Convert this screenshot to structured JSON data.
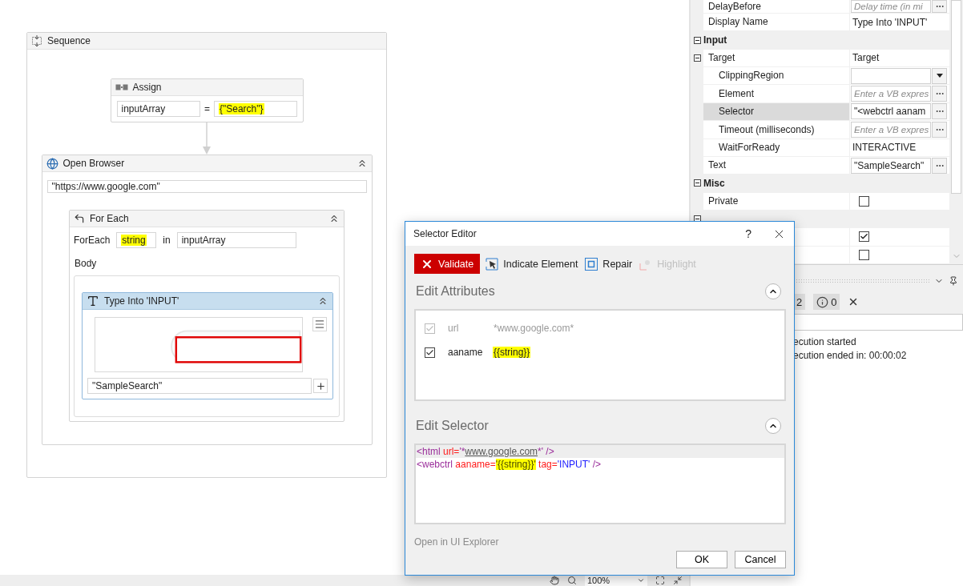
{
  "designer": {
    "sequence": {
      "title": "Sequence",
      "assign": {
        "title": "Assign",
        "target": "inputArray",
        "operator": "=",
        "value": {
          "text": "{\"Search\"}",
          "highlighted": true
        }
      },
      "open_browser": {
        "title": "Open Browser",
        "expanded": true,
        "url": "\"https://www.google.com\"",
        "for_each": {
          "title": "For Each",
          "expanded": true,
          "label": "ForEach",
          "item": {
            "text": "string",
            "highlighted": true
          },
          "in_label": "in",
          "collection": "inputArray",
          "body_label": "Body",
          "type_into": {
            "title": "Type Into 'INPUT'",
            "expanded": true,
            "selected": true,
            "text": "\"SampleSearch\""
          }
        }
      }
    }
  },
  "status_bar": {
    "zoom": "100%"
  },
  "properties": [
    {
      "kind": "field",
      "name": "DelayBefore",
      "placeholder": "Delay time (in mi",
      "has_button": true,
      "selected": false
    },
    {
      "kind": "field",
      "name": "Display Name",
      "value": "Type Into 'INPUT'",
      "selected": false
    },
    {
      "kind": "category",
      "name": "Input",
      "expanded": true,
      "children": [
        {
          "kind": "field",
          "name": "Target",
          "value": "Target",
          "expanded": true,
          "selected": false,
          "children": [
            {
              "kind": "dropdown",
              "name": "ClippingRegion",
              "selected": false
            },
            {
              "kind": "field",
              "name": "Element",
              "placeholder": "Enter a VB expres",
              "has_button": true,
              "selected": false
            },
            {
              "kind": "field",
              "name": "Selector",
              "value": "\"<webctrl aanam",
              "has_button": true,
              "selected": true
            },
            {
              "kind": "field",
              "name": "Timeout (milliseconds)",
              "placeholder": "Enter a VB expres",
              "has_button": true,
              "selected": false
            },
            {
              "kind": "field",
              "name": "WaitForReady",
              "value": "INTERACTIVE",
              "selected": false
            }
          ]
        },
        {
          "kind": "field",
          "name": "Text",
          "value": "\"SampleSearch\"",
          "has_button": true,
          "selected": false
        }
      ]
    },
    {
      "kind": "category",
      "name": "Misc",
      "expanded": true,
      "children": [
        {
          "kind": "checkbox",
          "name": "Private",
          "checked": false,
          "selected": false
        }
      ]
    },
    {
      "kind": "category",
      "expanded": true,
      "children": [
        {
          "kind": "checkbox",
          "checked": true,
          "selected": false
        },
        {
          "kind": "checkbox",
          "checked": false,
          "selected": false
        }
      ]
    }
  ],
  "output": {
    "error_count": "2",
    "info_count": "0",
    "lines": [
      "ecution started",
      "ecution ended in: 00:00:02"
    ]
  },
  "dialog": {
    "title": "Selector Editor",
    "help": "?",
    "toolbar": [
      {
        "kind": "validate",
        "label": "Validate",
        "disabled": false
      },
      {
        "kind": "indicate",
        "label": "Indicate Element",
        "disabled": false
      },
      {
        "kind": "repair",
        "label": "Repair",
        "disabled": false
      },
      {
        "kind": "highlight",
        "label": "Highlight",
        "disabled": true
      }
    ],
    "attributes_section": {
      "title": "Edit Attributes",
      "expanded": true,
      "attributes": [
        {
          "name": "url",
          "value": "*www.google.com*",
          "checked": true,
          "disabled": true,
          "highlighted": false
        },
        {
          "name": "aaname",
          "value": "{{string}}",
          "checked": true,
          "disabled": false,
          "highlighted": true
        }
      ]
    },
    "selector_section": {
      "title": "Edit Selector",
      "expanded": true,
      "lines": [
        {
          "current": true,
          "tokens": [
            {
              "text": "<html",
              "kind": "tag"
            },
            {
              "text": " url=",
              "kind": "attr"
            },
            {
              "text": "'*",
              "kind": "tag"
            },
            {
              "text": "www.google.com",
              "kind": "link"
            },
            {
              "text": "*' />",
              "kind": "tag"
            }
          ]
        },
        {
          "current": false,
          "tokens": [
            {
              "text": "<webctrl",
              "kind": "tag"
            },
            {
              "text": " aaname=",
              "kind": "attr"
            },
            {
              "text": "'{{string}}'",
              "kind": "value",
              "highlighted": true
            },
            {
              "text": " tag=",
              "kind": "attr"
            },
            {
              "text": "'INPUT'",
              "kind": "value"
            },
            {
              "text": " />",
              "kind": "tag"
            }
          ]
        }
      ]
    },
    "link": "Open in UI Explorer",
    "buttons": [
      {
        "label": "OK"
      },
      {
        "label": "Cancel"
      }
    ]
  }
}
